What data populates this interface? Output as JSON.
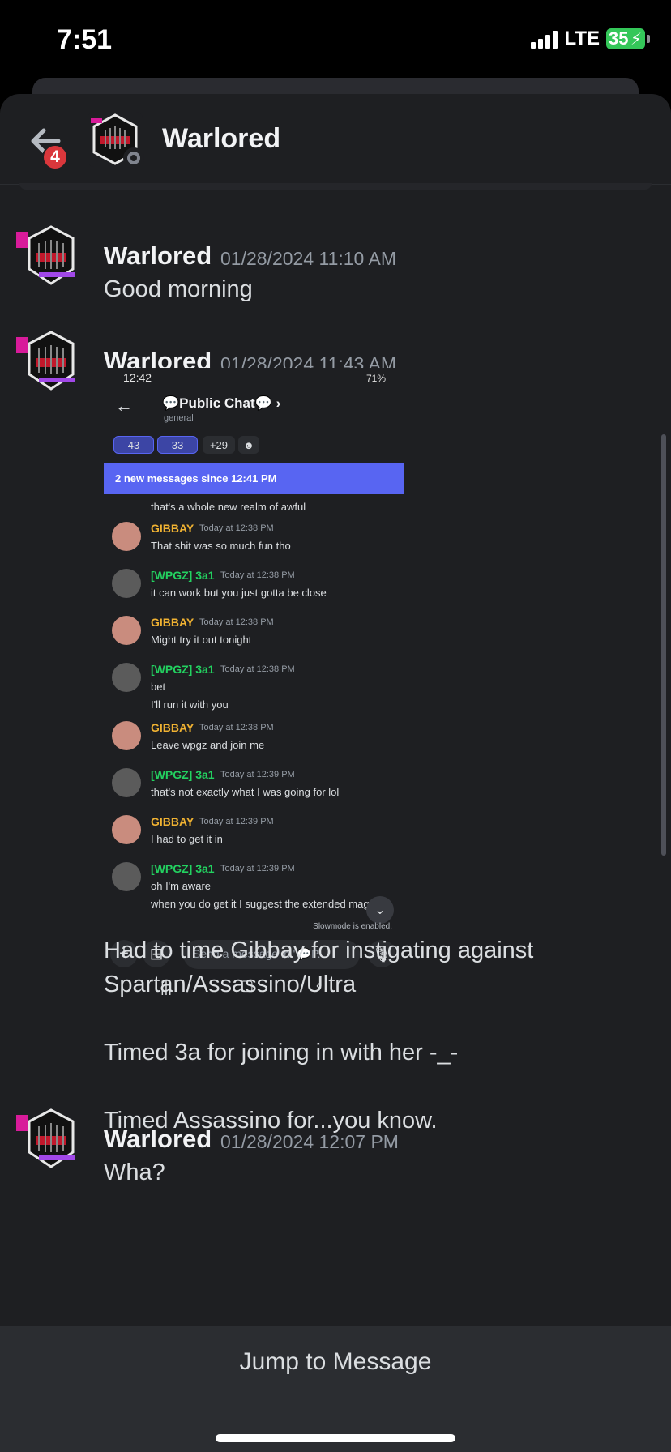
{
  "status_bar": {
    "time": "7:51",
    "network": "LTE",
    "battery": "35"
  },
  "header": {
    "title": "Warlored",
    "unread_badge": "4"
  },
  "messages": [
    {
      "author": "Warlored",
      "timestamp": "01/28/2024 11:10 AM",
      "text": "Good morning"
    },
    {
      "author": "Warlored",
      "timestamp": "01/28/2024 11:43 AM",
      "attachment": {
        "status_time": "12:42",
        "status_right": "71%",
        "channel_title": "💬Public Chat💬 ›",
        "channel_sub": "general",
        "pills": [
          "43",
          "33",
          "+29"
        ],
        "new_messages_bar": "2 new messages since 12:41 PM",
        "cut_text": "that's a whole new realm of awful",
        "chat": [
          {
            "name": "GIBBAY",
            "time": "Today at 12:38 PM",
            "lines": [
              "That shit was so much fun tho"
            ],
            "color": "gold"
          },
          {
            "name": "[WPGZ] 3a1",
            "time": "Today at 12:38 PM",
            "lines": [
              "it can work but you just gotta be close"
            ],
            "color": "green"
          },
          {
            "name": "GIBBAY",
            "time": "Today at 12:38 PM",
            "lines": [
              "Might try it out tonight"
            ],
            "color": "gold"
          },
          {
            "name": "[WPGZ] 3a1",
            "time": "Today at 12:38 PM",
            "lines": [
              "bet",
              "I'll run it with you"
            ],
            "color": "green"
          },
          {
            "name": "GIBBAY",
            "time": "Today at 12:38 PM",
            "lines": [
              "Leave wpgz and join me"
            ],
            "color": "gold"
          },
          {
            "name": "[WPGZ] 3a1",
            "time": "Today at 12:39 PM",
            "lines": [
              "that's not exactly what I was going for lol"
            ],
            "color": "green"
          },
          {
            "name": "GIBBAY",
            "time": "Today at 12:39 PM",
            "lines": [
              "I had to get it in"
            ],
            "color": "gold"
          },
          {
            "name": "[WPGZ] 3a1",
            "time": "Today at 12:39 PM",
            "lines": [
              "oh I'm aware",
              "when you do get it I suggest the extended mag"
            ],
            "color": "green"
          }
        ],
        "slowmode": "Slowmode is enabled.",
        "input_placeholder": "Send a message in \"💬P..."
      },
      "text_lines": [
        "Had to time Gibbay for instigating against",
        "Spartan/Assassino/Ultra",
        "",
        "Timed 3a for joining in with her -_-",
        "",
        "Timed Assassino for...you know."
      ]
    },
    {
      "author": "Warlored",
      "timestamp": "01/28/2024 12:07 PM",
      "text": "Wha?"
    }
  ],
  "jump_to_message": "Jump to Message",
  "colors": {
    "background": "#1e1f22",
    "blurple": "#5865f2",
    "badge_red": "#da373c",
    "gold": "#f0b232",
    "green": "#23d160"
  }
}
